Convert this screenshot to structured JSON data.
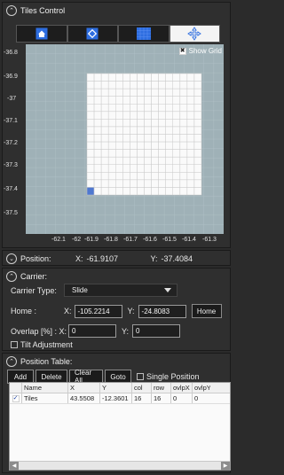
{
  "tiles_control": {
    "title": "Tiles Control",
    "toolbar": [
      {
        "icon": "home-icon",
        "active": false
      },
      {
        "icon": "tile-outline-icon",
        "active": false
      },
      {
        "icon": "grid-icon",
        "active": false
      },
      {
        "icon": "move-arrows-icon",
        "active": true
      }
    ],
    "show_grid_label": "Show Grid",
    "show_grid_checked": true,
    "y_ticks": [
      "-36.8",
      "-36.9",
      "-37",
      "-37.1",
      "-37.2",
      "-37.3",
      "-37.4",
      "-37.5"
    ],
    "x_ticks": [
      "-62.1",
      "-62",
      "-61.9",
      "-61.8",
      "-61.7",
      "-61.6",
      "-61.5",
      "-61.4",
      "-61.3"
    ],
    "grid": {
      "cols": 16,
      "rows": 16,
      "selected_col": 1,
      "selected_row": 16
    },
    "colors": {
      "plot_bg": "#9fb1b7",
      "tile_fill": "#fafafa",
      "tile_line": "#c9c9c9",
      "selected_tile": "#4f78d0"
    }
  },
  "position": {
    "label": "Position:",
    "x_label": "X:",
    "x_value": "-61.9107",
    "y_label": "Y:",
    "y_value": "-37.4084"
  },
  "carrier": {
    "title": "Carrier:",
    "type_label": "Carrier Type:",
    "type_value": "Slide",
    "home_label": "Home :",
    "x_label": "X:",
    "home_x": "-105.2214",
    "y_label": "Y:",
    "home_y": "-24.8083",
    "home_button": "Home",
    "overlap_label": "Overlap [%] : X:",
    "overlap_x": "0",
    "overlap_y_label": "Y:",
    "overlap_y": "0",
    "tilt_label": "Tilt Adjustment",
    "tilt_checked": false
  },
  "position_table": {
    "title": "Position Table:",
    "buttons": {
      "add": "Add",
      "delete": "Delete",
      "clear_all": "Clear All",
      "goto": "Goto"
    },
    "single_position_label": "Single Position",
    "single_position_checked": false,
    "columns": [
      "Name",
      "X",
      "Y",
      "col",
      "row",
      "ovlpX",
      "ovlpY"
    ],
    "rows": [
      {
        "checked": true,
        "Name": "Tiles",
        "X": "43.5508",
        "Y": "-12.3601",
        "col": "16",
        "row": "16",
        "ovlpX": "0",
        "ovlpY": "0"
      }
    ]
  }
}
